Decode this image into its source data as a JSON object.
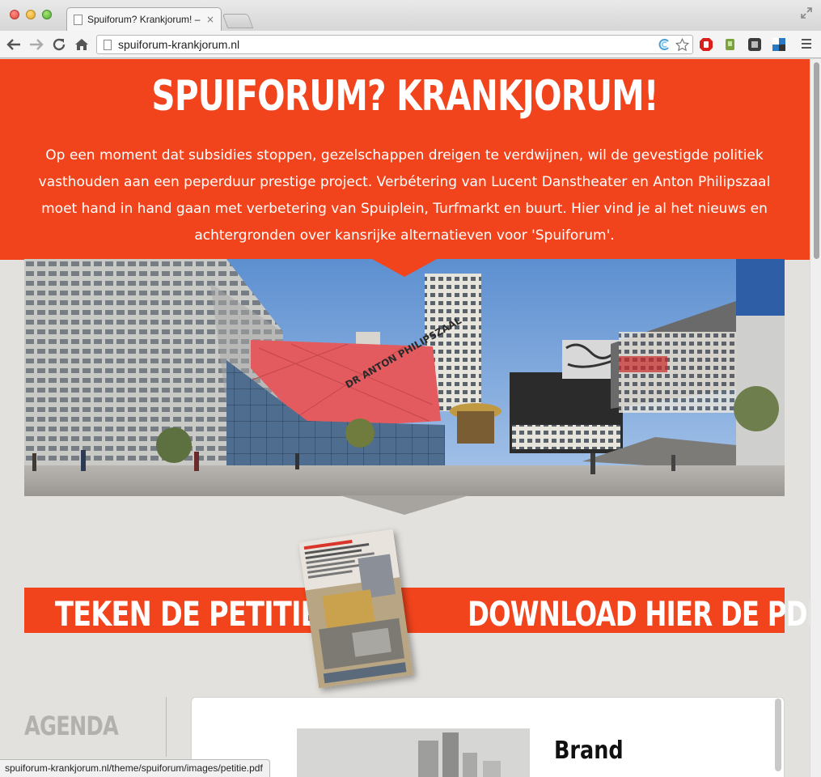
{
  "browser": {
    "tab_title": "Spuiforum? Krankjorum! –",
    "tab_close": "×",
    "url": "spuiforum-krankjorum.nl",
    "status_url": "spuiforum-krankjorum.nl/theme/spuiforum/images/petitie.pdf"
  },
  "hero": {
    "title": "SPUIFORUM? KRANKJORUM!",
    "intro": "Op een moment dat subsidies stoppen, gezelschappen dreigen te verdwijnen, wil de gevestigde politiek vasthouden aan een peperduur prestige project. Verbétering van Lucent Danstheater en Anton Philipszaal moet hand in hand gaan met verbetering van Spuiplein, Turfmarkt en buurt. Hier vind je al het nieuws en achtergronden over kansrijke alternatieven voor 'Spuiforum'.",
    "photo_sign": "DR ANTON PHILIPSZAAL"
  },
  "cta": {
    "petition_label": "TEKEN DE PETITIE",
    "pdf_label": "DOWNLOAD HIER DE PDF"
  },
  "agenda": {
    "heading": "AGENDA",
    "first_item_title": "Brand"
  },
  "colors": {
    "brand_orange": "#f2441c",
    "page_bg": "#e3e1dd"
  }
}
